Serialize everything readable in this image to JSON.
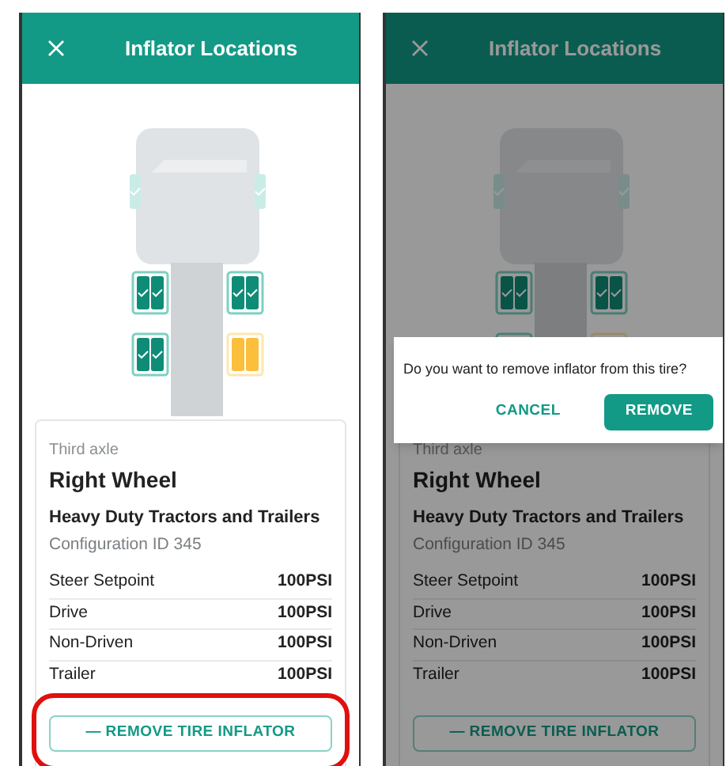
{
  "screens": [
    {
      "title": "Inflator Locations",
      "axles": [
        {
          "kind": "steer",
          "wheels": [
            {
              "selected": false
            },
            {
              "selected": false
            }
          ]
        },
        {
          "kind": "dual",
          "wheels": [
            {
              "selected": false
            },
            {
              "selected": false
            }
          ]
        },
        {
          "kind": "dual",
          "wheels": [
            {
              "selected": false
            },
            {
              "selected": true
            }
          ]
        }
      ],
      "axle_label": "Third axle",
      "wheel_name": "Right Wheel",
      "vehicle": "Heavy Duty Tractors and Trailers",
      "configuration": "Configuration ID 345",
      "pressures": [
        {
          "label": "Steer Setpoint",
          "value": "100PSI"
        },
        {
          "label": "Drive",
          "value": "100PSI"
        },
        {
          "label": "Non-Driven",
          "value": "100PSI"
        },
        {
          "label": "Trailer",
          "value": "100PSI"
        }
      ],
      "button": "— REMOVE TIRE INFLATOR",
      "highlighted": true
    },
    {
      "title": "Inflator Locations",
      "axles": [
        {
          "kind": "steer",
          "wheels": [
            {
              "selected": false
            },
            {
              "selected": false
            }
          ]
        },
        {
          "kind": "dual",
          "wheels": [
            {
              "selected": false
            },
            {
              "selected": false
            }
          ]
        },
        {
          "kind": "dual",
          "wheels": [
            {
              "selected": false
            },
            {
              "selected": true
            }
          ]
        }
      ],
      "axle_label": "Third axle",
      "wheel_name": "Right Wheel",
      "vehicle": "Heavy Duty Tractors and Trailers",
      "configuration": "Configuration ID 345",
      "pressures": [
        {
          "label": "Steer Setpoint",
          "value": "100PSI"
        },
        {
          "label": "Drive",
          "value": "100PSI"
        },
        {
          "label": "Non-Driven",
          "value": "100PSI"
        },
        {
          "label": "Trailer",
          "value": "100PSI"
        }
      ],
      "button": "— REMOVE TIRE INFLATOR",
      "highlighted": false,
      "dialog": {
        "message": "Do you want to remove inflator from this tire?",
        "cancel": "CANCEL",
        "confirm": "REMOVE"
      }
    }
  ]
}
